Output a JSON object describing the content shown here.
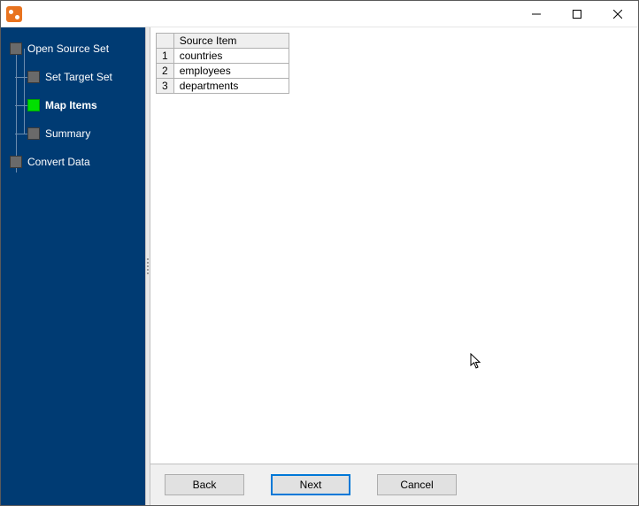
{
  "window": {
    "title": ""
  },
  "sidebar": {
    "items": [
      {
        "label": "Open Source Set",
        "active": false,
        "level": 0
      },
      {
        "label": "Set Target Set",
        "active": false,
        "level": 1
      },
      {
        "label": "Map Items",
        "active": true,
        "level": 1
      },
      {
        "label": "Summary",
        "active": false,
        "level": 1
      },
      {
        "label": "Convert Data",
        "active": false,
        "level": 0
      }
    ]
  },
  "grid": {
    "header": "Source Item",
    "rows": [
      {
        "num": "1",
        "item": "countries"
      },
      {
        "num": "2",
        "item": "employees"
      },
      {
        "num": "3",
        "item": "departments"
      }
    ]
  },
  "buttons": {
    "back": "Back",
    "next": "Next",
    "cancel": "Cancel"
  }
}
